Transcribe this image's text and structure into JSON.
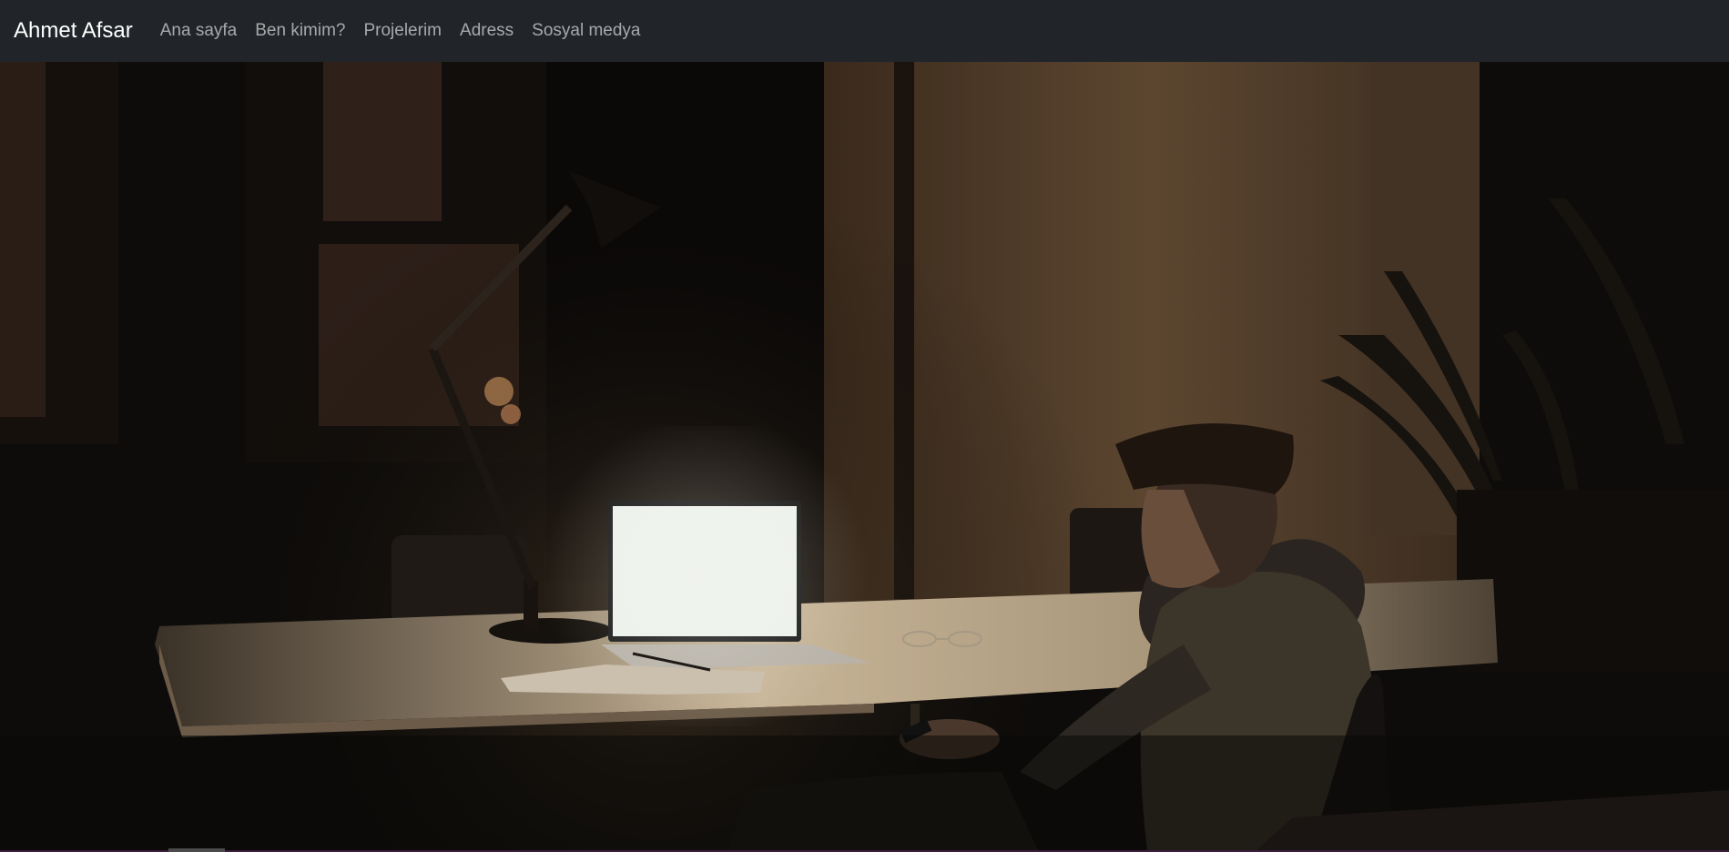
{
  "navbar": {
    "brand": "Ahmet Afsar",
    "links": [
      "Ana sayfa",
      "Ben kimim?",
      "Projelerim",
      "Adress",
      "Sosyal medya"
    ]
  },
  "hero": {
    "image": "dark-office-person-laptop-photo"
  },
  "colors": {
    "navbar_bg": "#212529",
    "brand_text": "#ffffff",
    "link_text": "#9a9da0"
  }
}
